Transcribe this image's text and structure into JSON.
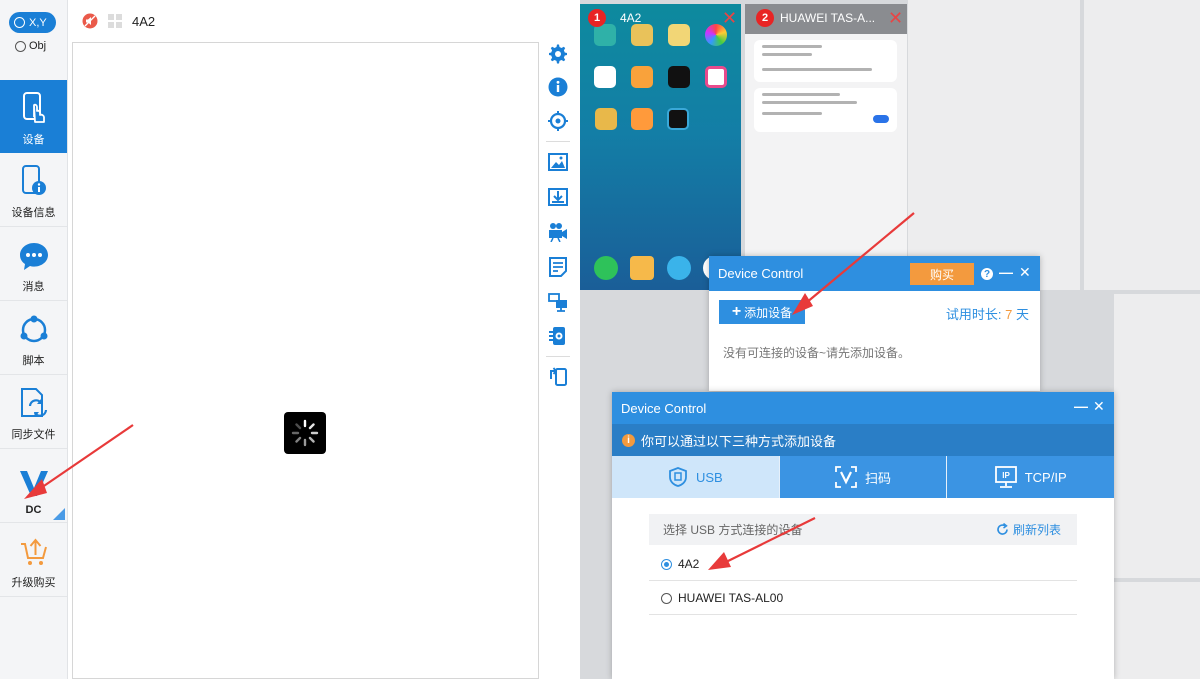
{
  "sidebar": {
    "xy_label": "X,Y",
    "obj_label": "Obj",
    "items": [
      {
        "label": "设备"
      },
      {
        "label": "设备信息"
      },
      {
        "label": "消息"
      },
      {
        "label": "脚本"
      },
      {
        "label": "同步文件"
      },
      {
        "label": "DC"
      },
      {
        "label": "升级购买"
      }
    ]
  },
  "topbar": {
    "device_name": "4A2"
  },
  "thumbs": [
    {
      "badge": "1",
      "title": "4A2"
    },
    {
      "badge": "2",
      "title": "HUAWEI TAS-A..."
    }
  ],
  "dialog1": {
    "title": "Device Control",
    "buy_label": "购买",
    "help_icon": "?",
    "min_icon": "—",
    "close_icon": "✕",
    "add_label": "添加设备",
    "trial_label": "试用时长:",
    "trial_value": "7",
    "trial_unit": "天",
    "empty_message": "没有可连接的设备~请先添加设备。"
  },
  "dialog2": {
    "title": "Device Control",
    "min_icon": "—",
    "close_icon": "✕",
    "info_text": "你可以通过以下三种方式添加设备",
    "tabs": [
      {
        "label": "USB"
      },
      {
        "label": "扫码"
      },
      {
        "label": "TCP/IP"
      }
    ],
    "list_header": "选择 USB 方式连接的设备",
    "refresh_label": "刷新列表",
    "devices": [
      {
        "name": "4A2"
      },
      {
        "name": "HUAWEI TAS-AL00"
      }
    ]
  },
  "colors": {
    "accent": "#1a7fd6",
    "dialog_blue": "#2e8fe0",
    "buy_orange": "#f39a3e",
    "badge_red": "#e82424",
    "arrow_red": "#e83a3a"
  }
}
